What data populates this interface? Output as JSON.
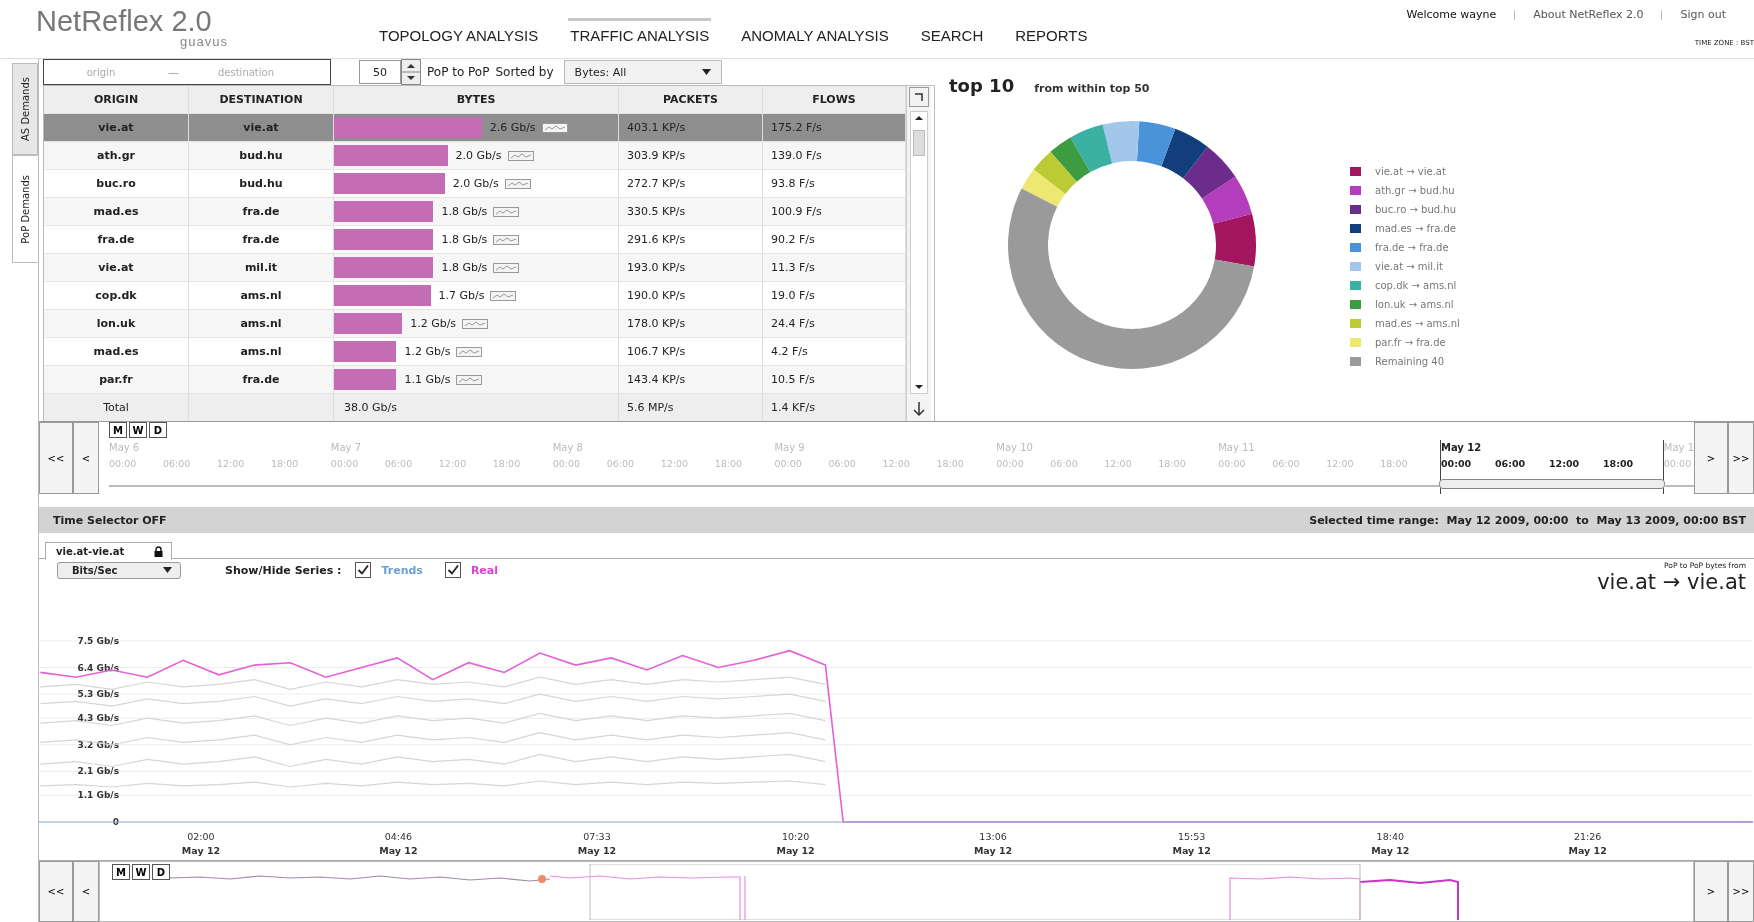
{
  "header": {
    "logo": "NetReflex 2.0",
    "logo_sub": "guavus",
    "nav": [
      {
        "label": "TOPOLOGY ANALYSIS",
        "selected": false
      },
      {
        "label": "TRAFFIC ANALYSIS",
        "selected": true
      },
      {
        "label": "ANOMALY ANALYSIS",
        "selected": false
      },
      {
        "label": "SEARCH",
        "selected": false
      },
      {
        "label": "REPORTS",
        "selected": false
      }
    ],
    "user_links": [
      "Welcome wayne",
      "About NetReflex 2.0",
      "Sign out"
    ],
    "time_zone": "TIME ZONE : BST"
  },
  "side_tabs": [
    {
      "label": "AS Demands",
      "selected": false
    },
    {
      "label": "PoP Demands",
      "selected": true
    }
  ],
  "table_controls": {
    "origin": {
      "placeholder": "origin"
    },
    "separator": "—",
    "destination": {
      "placeholder": "destination"
    },
    "count": "50",
    "mode": "PoP to PoP",
    "sorted_label": "Sorted by",
    "sort": "Bytes: All"
  },
  "table": {
    "columns": [
      "ORIGIN",
      "DESTINATION",
      "BYTES",
      "PACKETS",
      "FLOWS"
    ],
    "rows": [
      {
        "origin": "vie.at",
        "destination": "vie.at",
        "bytes": "2.6 Gb/s",
        "level": 0.52,
        "packets": "403.1 KP/s",
        "flows": "175.2 F/s",
        "selected": true
      },
      {
        "origin": "ath.gr",
        "destination": "bud.hu",
        "bytes": "2.0 Gb/s",
        "level": 0.4,
        "packets": "303.9 KP/s",
        "flows": "139.0 F/s",
        "selected": false
      },
      {
        "origin": "buc.ro",
        "destination": "bud.hu",
        "bytes": "2.0 Gb/s",
        "level": 0.39,
        "packets": "272.7 KP/s",
        "flows": "93.8 F/s",
        "selected": false
      },
      {
        "origin": "mad.es",
        "destination": "fra.de",
        "bytes": "1.8 Gb/s",
        "level": 0.35,
        "packets": "330.5 KP/s",
        "flows": "100.9 F/s",
        "selected": false
      },
      {
        "origin": "fra.de",
        "destination": "fra.de",
        "bytes": "1.8 Gb/s",
        "level": 0.35,
        "packets": "291.6 KP/s",
        "flows": "90.2 F/s",
        "selected": false
      },
      {
        "origin": "vie.at",
        "destination": "mil.it",
        "bytes": "1.8 Gb/s",
        "level": 0.35,
        "packets": "193.0 KP/s",
        "flows": "11.3 F/s",
        "selected": false
      },
      {
        "origin": "cop.dk",
        "destination": "ams.nl",
        "bytes": "1.7 Gb/s",
        "level": 0.34,
        "packets": "190.0 KP/s",
        "flows": "19.0 F/s",
        "selected": false
      },
      {
        "origin": "lon.uk",
        "destination": "ams.nl",
        "bytes": "1.2 Gb/s",
        "level": 0.24,
        "packets": "178.0 KP/s",
        "flows": "24.4 F/s",
        "selected": false
      },
      {
        "origin": "mad.es",
        "destination": "ams.nl",
        "bytes": "1.2 Gb/s",
        "level": 0.22,
        "packets": "106.7 KP/s",
        "flows": "4.2 F/s",
        "selected": false
      },
      {
        "origin": "par.fr",
        "destination": "fra.de",
        "bytes": "1.1 Gb/s",
        "level": 0.22,
        "packets": "143.4 KP/s",
        "flows": "10.5 F/s",
        "selected": false
      }
    ],
    "total": {
      "label": "Total",
      "bytes": "38.0 Gb/s",
      "packets": "5.6 MP/s",
      "flows": "1.4 KF/s"
    }
  },
  "top_panel": {
    "title": "top 10",
    "subtitle": "from within top  50",
    "legend": [
      {
        "color": "#a3165f"
      },
      {
        "color": "#b43dbb"
      },
      {
        "color": "#6b2c8c"
      },
      {
        "color": "#123f7c"
      },
      {
        "color": "#4b93d9"
      },
      {
        "color": "#a3c7ea"
      },
      {
        "color": "#3bb0a3"
      },
      {
        "color": "#3d9c42"
      },
      {
        "color": "#bccb34"
      },
      {
        "color": "#ede872"
      },
      {
        "color": "#9a9a9a"
      }
    ],
    "chart_data": {
      "type": "donut",
      "categories": [
        "vie.at → vie.at",
        "ath.gr → bud.hu",
        "buc.ro → bud.hu",
        "mad.es → fra.de",
        "fra.de → fra.de",
        "vie.at → mil.it",
        "cop.dk → ams.nl",
        "lon.uk → ams.nl",
        "mad.es → ams.nl",
        "par.fr → fra.de",
        "Remaining 40"
      ],
      "values": [
        6.84,
        5.26,
        5.26,
        4.74,
        4.74,
        4.74,
        4.47,
        3.16,
        3.16,
        2.89,
        54.74
      ]
    }
  },
  "timeline": {
    "left_buttons": [
      "<<",
      "<"
    ],
    "zoom_buttons": [
      "M",
      "W",
      "D"
    ],
    "right_buttons": [
      ">",
      ">>"
    ],
    "days": [
      {
        "date": "May 6",
        "hours": [
          "00:00",
          "06:00",
          "12:00",
          "18:00"
        ],
        "selected": false
      },
      {
        "date": "May 7",
        "hours": [
          "00:00",
          "06:00",
          "12:00",
          "18:00"
        ],
        "selected": false
      },
      {
        "date": "May 8",
        "hours": [
          "00:00",
          "06:00",
          "12:00",
          "18:00"
        ],
        "selected": false
      },
      {
        "date": "May 9",
        "hours": [
          "00:00",
          "06:00",
          "12:00",
          "18:00"
        ],
        "selected": false
      },
      {
        "date": "May 10",
        "hours": [
          "00:00",
          "06:00",
          "12:00",
          "18:00"
        ],
        "selected": false
      },
      {
        "date": "May 11",
        "hours": [
          "00:00",
          "06:00",
          "12:00",
          "18:00"
        ],
        "selected": false
      },
      {
        "date": "May 12",
        "hours": [
          "00:00",
          "06:00",
          "12:00",
          "18:00"
        ],
        "selected": true
      },
      {
        "date": "May 1",
        "hours": [
          "00:00"
        ],
        "selected": false
      }
    ]
  },
  "time_selector": {
    "status": "Time Selector OFF",
    "range": "Selected time range:  May 12 2009, 00:00  to  May 13 2009, 00:00 BST"
  },
  "chart_panel": {
    "tab": "vie.at-vie.at",
    "units": "Bits/Sec",
    "series_label": "Show/Hide Series :",
    "series_toggles": [
      {
        "label": "Trends",
        "checked": true,
        "color": "#6e9fd2"
      },
      {
        "label": "Real",
        "checked": true,
        "color": "#e23fd6"
      }
    ],
    "title_small": "PoP to PoP  bytes from",
    "title": "vie.at → vie.at",
    "x_date_labels": [
      "May 12",
      "May 12",
      "May 12",
      "May 12",
      "May 12",
      "May 12",
      "May 12",
      "May 12"
    ],
    "chart_data": {
      "type": "line",
      "x": [
        -0.25,
        0.25,
        0.75,
        1.25,
        1.75,
        2.25,
        2.75,
        3.25,
        3.75,
        4.25,
        4.75,
        5.25,
        5.75,
        6.25,
        6.75,
        7.25,
        7.75,
        8.25,
        8.75,
        9.25,
        9.75,
        10.25,
        10.75,
        11.0,
        23.75
      ],
      "xlim": [
        -0.27,
        23.75
      ],
      "ylim": [
        0,
        7.5
      ],
      "grid": true,
      "xticks": [
        {
          "value": 2,
          "label": "02:00"
        },
        {
          "value": 4.767,
          "label": "04:46"
        },
        {
          "value": 7.55,
          "label": "07:33"
        },
        {
          "value": 10.333,
          "label": "10:20"
        },
        {
          "value": 13.1,
          "label": "13:06"
        },
        {
          "value": 15.883,
          "label": "15:53"
        },
        {
          "value": 18.667,
          "label": "18:40"
        },
        {
          "value": 21.433,
          "label": "21:26"
        }
      ],
      "yticks": [
        {
          "value": 0,
          "label": "0"
        },
        {
          "value": 1.1,
          "label": "1.1 Gb/s"
        },
        {
          "value": 2.1,
          "label": "2.1 Gb/s"
        },
        {
          "value": 3.2,
          "label": "3.2 Gb/s"
        },
        {
          "value": 4.3,
          "label": "4.3 Gb/s"
        },
        {
          "value": 5.3,
          "label": "5.3 Gb/s"
        },
        {
          "value": 6.4,
          "label": "6.4 Gb/s"
        },
        {
          "value": 7.5,
          "label": "7.5 Gb/s"
        }
      ],
      "series": [
        {
          "color": "#d6d6d6",
          "values": [
            5.6,
            5.7,
            5.5,
            5.8,
            5.6,
            5.7,
            5.9,
            5.5,
            5.8,
            5.6,
            5.9,
            5.7,
            5.8,
            5.6,
            6.0,
            5.7,
            5.9,
            5.7,
            5.9,
            5.8,
            5.9,
            6.0,
            5.7,
            null,
            null
          ]
        },
        {
          "color": "#d6d6d6",
          "values": [
            4.9,
            5.0,
            4.8,
            5.1,
            4.9,
            5.0,
            5.2,
            4.8,
            5.1,
            4.9,
            5.2,
            5.0,
            5.1,
            4.9,
            5.3,
            5.0,
            5.2,
            5.0,
            5.2,
            5.1,
            5.2,
            5.3,
            5.0,
            null,
            null
          ]
        },
        {
          "color": "#d6d6d6",
          "values": [
            4.1,
            4.2,
            4.0,
            4.3,
            4.1,
            4.2,
            4.4,
            4.0,
            4.3,
            4.1,
            4.4,
            4.2,
            4.3,
            4.1,
            4.5,
            4.2,
            4.4,
            4.2,
            4.4,
            4.3,
            4.4,
            4.5,
            4.2,
            null,
            null
          ]
        },
        {
          "color": "#d6d6d6",
          "values": [
            3.3,
            3.4,
            3.2,
            3.5,
            3.3,
            3.4,
            3.6,
            3.2,
            3.5,
            3.3,
            3.6,
            3.4,
            3.5,
            3.3,
            3.7,
            3.4,
            3.6,
            3.4,
            3.6,
            3.5,
            3.6,
            3.7,
            3.4,
            null,
            null
          ]
        },
        {
          "color": "#d6d6d6",
          "values": [
            2.4,
            2.5,
            2.3,
            2.6,
            2.4,
            2.5,
            2.7,
            2.3,
            2.6,
            2.4,
            2.7,
            2.5,
            2.6,
            2.4,
            2.8,
            2.5,
            2.7,
            2.5,
            2.7,
            2.6,
            2.7,
            2.8,
            2.5,
            null,
            null
          ]
        },
        {
          "color": "#d6d6d6",
          "values": [
            1.5,
            1.55,
            1.45,
            1.6,
            1.5,
            1.55,
            1.65,
            1.45,
            1.6,
            1.5,
            1.65,
            1.55,
            1.6,
            1.5,
            1.7,
            1.55,
            1.65,
            1.55,
            1.65,
            1.6,
            1.65,
            1.7,
            1.55,
            null,
            null
          ]
        },
        {
          "color": "#e55fd6",
          "values": [
            6.2,
            6.0,
            6.3,
            6.0,
            6.7,
            6.1,
            6.5,
            6.6,
            6.0,
            6.4,
            6.8,
            5.9,
            6.6,
            6.2,
            7.0,
            6.5,
            6.8,
            6.3,
            6.9,
            6.4,
            6.7,
            7.1,
            6.5,
            0,
            0
          ]
        }
      ]
    }
  },
  "navigator": {
    "left_buttons": [
      "<<",
      "<"
    ],
    "zoom_buttons": [
      "M",
      "W",
      "D"
    ],
    "right_buttons": [
      ">",
      ">>"
    ]
  }
}
